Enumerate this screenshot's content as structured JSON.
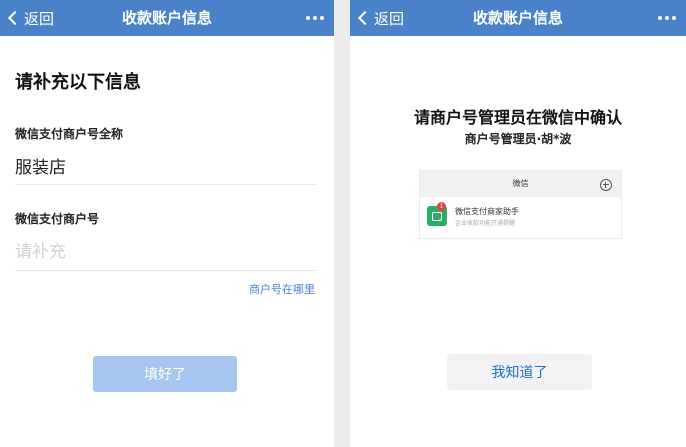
{
  "left_screen": {
    "navbar": {
      "back_label": "返回",
      "title": "收款账户信息"
    },
    "heading": "请补充以下信息",
    "merchant_fullname": {
      "label": "微信支付商户号全称",
      "value": "服装店"
    },
    "merchant_id": {
      "label": "微信支付商户号",
      "placeholder": "请补充",
      "value": ""
    },
    "help_link": "商户号在哪里",
    "submit_button": "填好了"
  },
  "right_screen": {
    "navbar": {
      "back_label": "返回",
      "title": "收款账户信息"
    },
    "confirm_title": "请商户号管理员在微信中确认",
    "admin_line": "商户号管理员·胡*波",
    "wechat_card": {
      "title": "微信",
      "badge_count": "1",
      "app_name": "微信支付商家助手",
      "app_subtitle": "企业收款功能开通提醒"
    },
    "acknowledge_button": "我知道了"
  },
  "colors": {
    "navbar": "#4a82c9",
    "link": "#4a82c9",
    "primary_button_disabled": "#a6c6ee",
    "secondary_button_text": "#1e6fd0",
    "app_icon": "#2aae67",
    "badge": "#e64340"
  },
  "icons": {
    "back": "chevron-left-icon",
    "more": "more-dots-icon",
    "plus": "plus-circle-icon",
    "app": "wechat-pay-merchant-icon"
  }
}
